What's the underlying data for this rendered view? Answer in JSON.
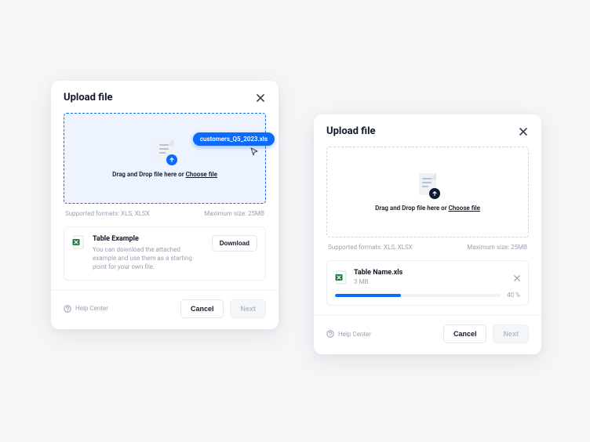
{
  "dialogA": {
    "title": "Upload file",
    "dropzone": {
      "text_prefix": "Drag and Drop file here or ",
      "choose": "Choose file",
      "dragging_file_name": "customers_Q5_2023.xls"
    },
    "hints": {
      "formats": "Supported formats:  XLS, XLSX",
      "maxsize": "Maximum size: 25MB"
    },
    "example": {
      "title": "Table Example",
      "desc": "You can download the attached example and use them as a starting point for your own file.",
      "download_label": "Download"
    },
    "footer": {
      "help": "Help Center",
      "cancel": "Cancel",
      "next": "Next"
    }
  },
  "dialogB": {
    "title": "Upload file",
    "dropzone": {
      "text_prefix": "Drag and Drop file here or ",
      "choose": "Choose file"
    },
    "hints": {
      "formats": "Supported formats:  XLS, XLSX",
      "maxsize": "Maximum size: 25MB"
    },
    "upload": {
      "name": "Table Name.xls",
      "size": "3 MB",
      "percent_label": "40 %",
      "percent_css": "40%"
    },
    "footer": {
      "help": "Help Center",
      "cancel": "Cancel",
      "next": "Next"
    }
  }
}
